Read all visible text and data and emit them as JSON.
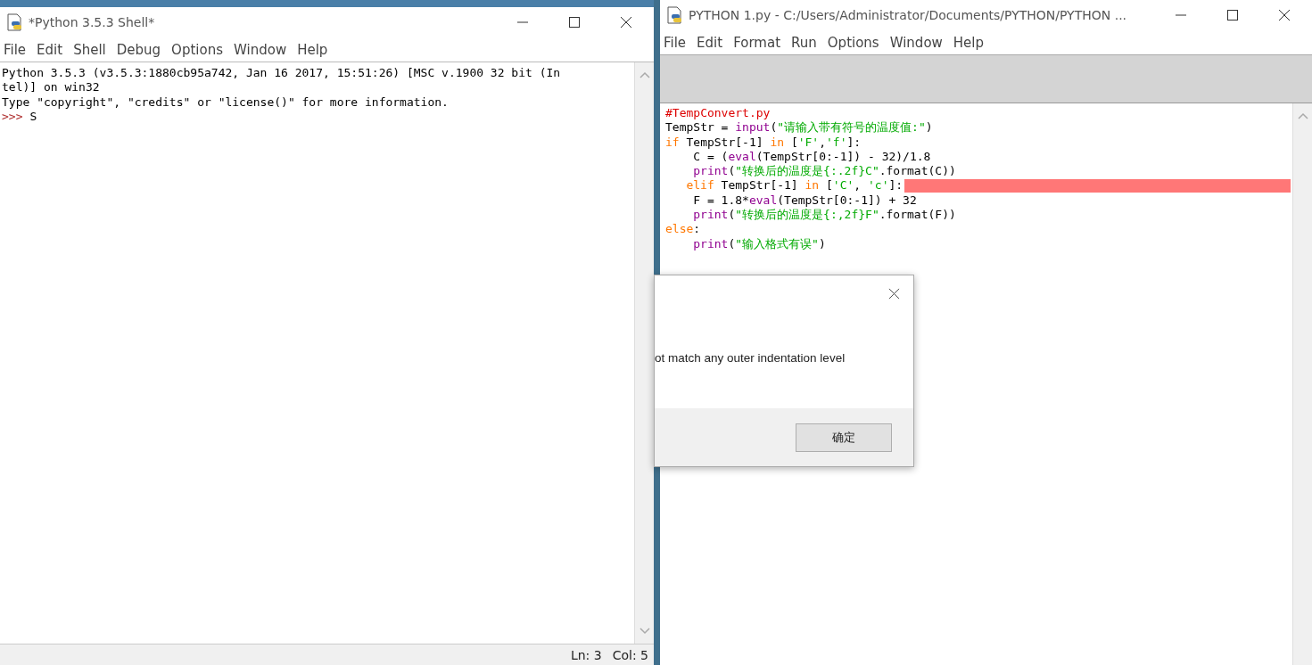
{
  "shell_window": {
    "title": "*Python 3.5.3 Shell*",
    "menu": [
      "File",
      "Edit",
      "Shell",
      "Debug",
      "Options",
      "Window",
      "Help"
    ],
    "output": [
      {
        "kind": "output",
        "text": "Python 3.5.3 (v3.5.3:1880cb95a742, Jan 16 2017, 15:51:26) [MSC v.1900 32 bit (In"
      },
      {
        "kind": "output",
        "text": "tel)] on win32"
      },
      {
        "kind": "output",
        "text": "Type \"copyright\", \"credits\" or \"license()\" for more information."
      },
      {
        "kind": "prompt",
        "prompt": ">>>",
        "text": "S"
      }
    ],
    "status": [
      "Ln: 3",
      "Col: 5"
    ]
  },
  "editor_window": {
    "title": "PYTHON 1.py - C:/Users/Administrator/Documents/PYTHON/PYTHON ...",
    "menu": [
      "File",
      "Edit",
      "Format",
      "Run",
      "Options",
      "Window",
      "Help"
    ],
    "code": [
      {
        "indented": false,
        "misaligned": false,
        "error": false,
        "tokens": [
          {
            "kind": "comment",
            "text": "#TempConvert.py"
          }
        ]
      },
      {
        "indented": false,
        "misaligned": false,
        "error": false,
        "tokens": [
          {
            "kind": "plain",
            "text": "TempStr = "
          },
          {
            "kind": "builtin",
            "text": "input"
          },
          {
            "kind": "plain",
            "text": "("
          },
          {
            "kind": "string",
            "text": "\"请输入带有符号的温度值:\""
          },
          {
            "kind": "plain",
            "text": ")"
          }
        ]
      },
      {
        "indented": false,
        "misaligned": false,
        "error": false,
        "tokens": [
          {
            "kind": "keyword",
            "text": "if"
          },
          {
            "kind": "plain",
            "text": " TempStr[-1] "
          },
          {
            "kind": "keyword",
            "text": "in"
          },
          {
            "kind": "plain",
            "text": " ["
          },
          {
            "kind": "string",
            "text": "'F'"
          },
          {
            "kind": "plain",
            "text": ","
          },
          {
            "kind": "string",
            "text": "'f'"
          },
          {
            "kind": "plain",
            "text": "]:"
          }
        ]
      },
      {
        "indented": true,
        "misaligned": false,
        "error": false,
        "tokens": [
          {
            "kind": "plain",
            "text": "C = ("
          },
          {
            "kind": "builtin",
            "text": "eval"
          },
          {
            "kind": "plain",
            "text": "(TempStr[0:-1]) - 32)/1.8"
          }
        ]
      },
      {
        "indented": true,
        "misaligned": false,
        "error": false,
        "tokens": [
          {
            "kind": "builtin",
            "text": "print"
          },
          {
            "kind": "plain",
            "text": "("
          },
          {
            "kind": "string",
            "text": "\"转换后的温度是{:.2f}C\""
          },
          {
            "kind": "plain",
            "text": ".format(C))"
          }
        ]
      },
      {
        "indented": true,
        "misaligned": true,
        "error": true,
        "tokens": [
          {
            "kind": "keyword",
            "text": "elif"
          },
          {
            "kind": "plain",
            "text": " TempStr[-1] "
          },
          {
            "kind": "keyword",
            "text": "in"
          },
          {
            "kind": "plain",
            "text": " ["
          },
          {
            "kind": "string",
            "text": "'C'"
          },
          {
            "kind": "plain",
            "text": ", "
          },
          {
            "kind": "string",
            "text": "'c'"
          },
          {
            "kind": "plain",
            "text": "]:"
          }
        ]
      },
      {
        "indented": true,
        "misaligned": false,
        "error": false,
        "tokens": [
          {
            "kind": "plain",
            "text": "F = 1.8*"
          },
          {
            "kind": "builtin",
            "text": "eval"
          },
          {
            "kind": "plain",
            "text": "(TempStr[0:-1]) + 32"
          }
        ]
      },
      {
        "indented": true,
        "misaligned": false,
        "error": false,
        "tokens": [
          {
            "kind": "builtin",
            "text": "print"
          },
          {
            "kind": "plain",
            "text": "("
          },
          {
            "kind": "string",
            "text": "\"转换后的温度是{:,2f}F\""
          },
          {
            "kind": "plain",
            "text": ".format(F))"
          }
        ]
      },
      {
        "indented": false,
        "misaligned": false,
        "error": false,
        "tokens": [
          {
            "kind": "keyword",
            "text": "else"
          },
          {
            "kind": "plain",
            "text": ":"
          }
        ]
      },
      {
        "indented": true,
        "misaligned": false,
        "error": false,
        "tokens": [
          {
            "kind": "builtin",
            "text": "print"
          },
          {
            "kind": "plain",
            "text": "("
          },
          {
            "kind": "string",
            "text": "\"输入格式有误\""
          },
          {
            "kind": "plain",
            "text": ")"
          }
        ]
      }
    ]
  },
  "dialog": {
    "message": "ot match any outer indentation level",
    "button": "确定"
  }
}
